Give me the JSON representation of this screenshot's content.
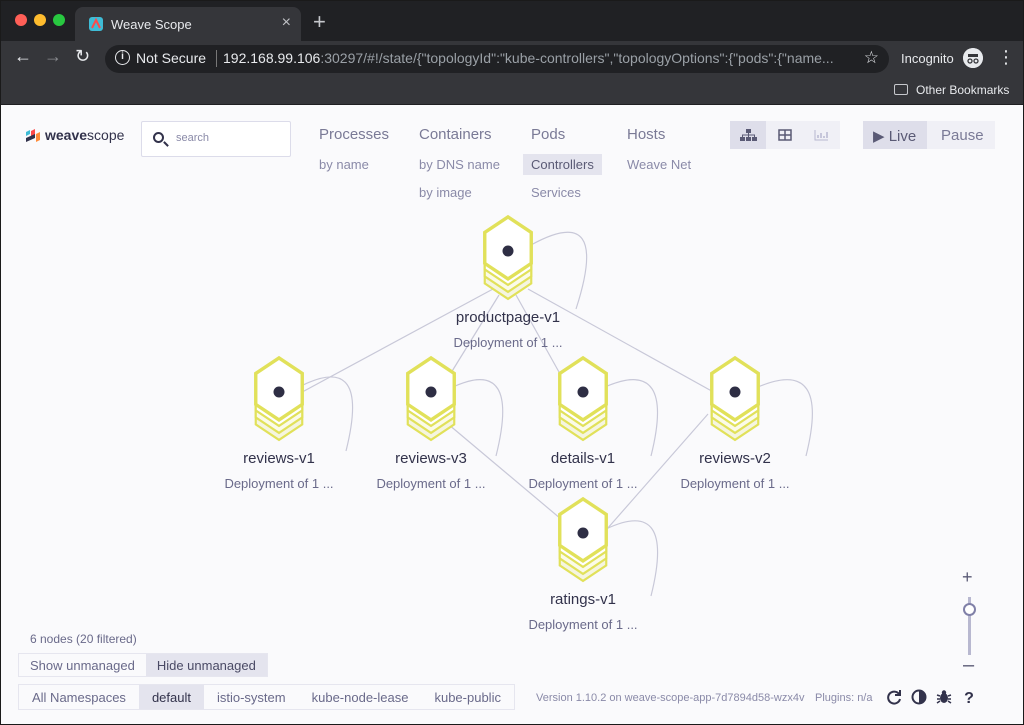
{
  "browser": {
    "tab_title": "Weave Scope",
    "security_label": "Not Secure",
    "url_host": "192.168.99.106",
    "url_rest": ":30297/#!/state/{\"topologyId\":\"kube-controllers\",\"topologyOptions\":{\"pods\":{\"name...",
    "profile_label": "Incognito",
    "bookmarks_folder": "Other Bookmarks"
  },
  "app": {
    "logo_part1": "weave",
    "logo_part2": "scope",
    "search_placeholder": "search"
  },
  "topologies": [
    {
      "label": "Processes",
      "subs": [
        "by name"
      ]
    },
    {
      "label": "Containers",
      "subs": [
        "by DNS name",
        "by image"
      ]
    },
    {
      "label": "Pods",
      "subs": [
        "Controllers",
        "Services"
      ],
      "active_sub": "Controllers"
    },
    {
      "label": "Hosts",
      "subs": [
        "Weave Net"
      ]
    }
  ],
  "view_modes": [
    "graph-view",
    "table-view",
    "resources-view"
  ],
  "live_controls": {
    "live": "Live",
    "pause": "Pause"
  },
  "graph": {
    "nodes": [
      {
        "name": "productpage-v1",
        "subtitle": "Deployment of 1 ..."
      },
      {
        "name": "reviews-v1",
        "subtitle": "Deployment of 1 ..."
      },
      {
        "name": "reviews-v3",
        "subtitle": "Deployment of 1 ..."
      },
      {
        "name": "details-v1",
        "subtitle": "Deployment of 1 ..."
      },
      {
        "name": "reviews-v2",
        "subtitle": "Deployment of 1 ..."
      },
      {
        "name": "ratings-v1",
        "subtitle": "Deployment of 1 ..."
      }
    ],
    "node_color": "#e1e15a"
  },
  "footer": {
    "node_count": "6 nodes (20 filtered)",
    "show_unmanaged": "Show unmanaged",
    "hide_unmanaged": "Hide unmanaged",
    "namespaces": [
      "All Namespaces",
      "default",
      "istio-system",
      "kube-node-lease",
      "kube-public"
    ],
    "active_namespace": "default",
    "version": "Version 1.10.2 on weave-scope-app-7d7894d58-wzx4v",
    "plugins": "Plugins: n/a"
  }
}
